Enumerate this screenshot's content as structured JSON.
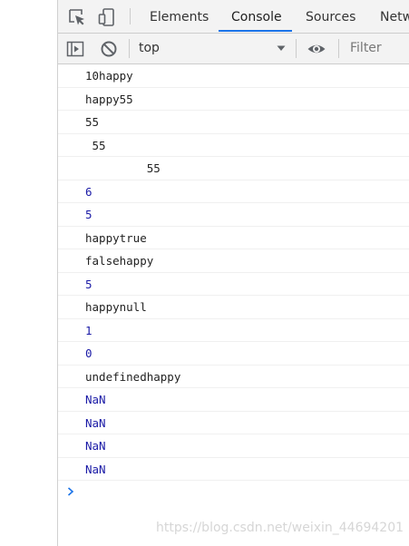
{
  "tabs": [
    {
      "label": "Elements",
      "active": false
    },
    {
      "label": "Console",
      "active": true
    },
    {
      "label": "Sources",
      "active": false
    },
    {
      "label": "Netw",
      "active": false
    }
  ],
  "toolbar": {
    "context": "top",
    "filter_placeholder": "Filter"
  },
  "icons": {
    "inspect": "inspect-element-icon",
    "device": "device-toolbar-icon",
    "sidebar": "show-console-sidebar-icon",
    "clear": "clear-console-icon",
    "dropdown": "chevron-down-icon",
    "live_expression": "eye-icon",
    "prompt": "chevron-right-icon"
  },
  "colors": {
    "accent": "#1a73e8",
    "number_output": "#1a1aa6",
    "string_output": "#222222",
    "toolbar_bg": "#f3f3f3"
  },
  "console": {
    "messages": [
      {
        "text": "10happy",
        "type": "string"
      },
      {
        "text": "happy55",
        "type": "string"
      },
      {
        "text": "55",
        "type": "string"
      },
      {
        "text": " 55",
        "type": "string"
      },
      {
        "text": "         55",
        "type": "string"
      },
      {
        "text": "6",
        "type": "number"
      },
      {
        "text": "5",
        "type": "number"
      },
      {
        "text": "happytrue",
        "type": "string"
      },
      {
        "text": "falsehappy",
        "type": "string"
      },
      {
        "text": "5",
        "type": "number"
      },
      {
        "text": "happynull",
        "type": "string"
      },
      {
        "text": "1",
        "type": "number"
      },
      {
        "text": "0",
        "type": "number"
      },
      {
        "text": "undefinedhappy",
        "type": "string"
      },
      {
        "text": "NaN",
        "type": "number"
      },
      {
        "text": "NaN",
        "type": "number"
      },
      {
        "text": "NaN",
        "type": "number"
      },
      {
        "text": "NaN",
        "type": "number"
      }
    ]
  },
  "watermark": "https://blog.csdn.net/weixin_44694201"
}
